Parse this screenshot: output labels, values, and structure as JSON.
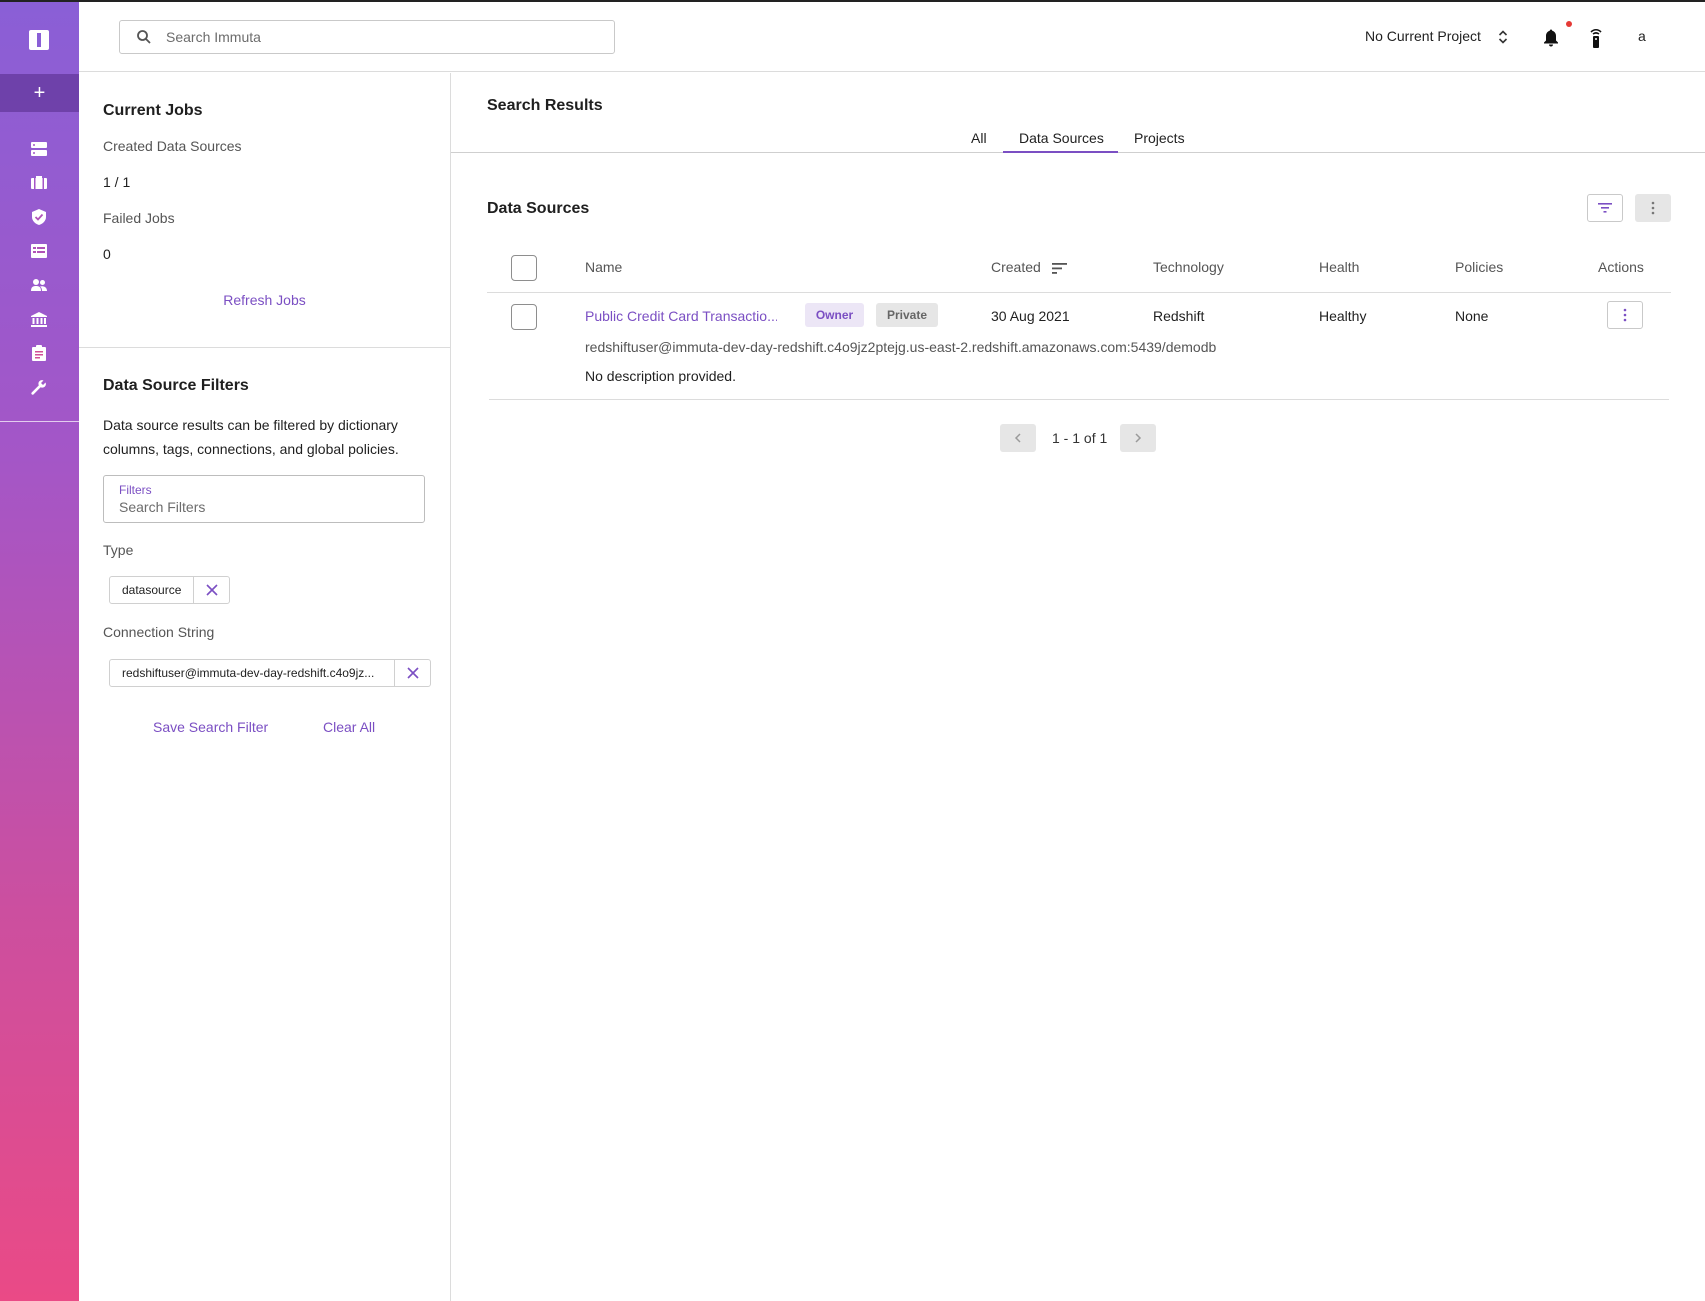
{
  "colors": {
    "accent": "#7b4fc3",
    "rail_top": "#8a5fd6",
    "rail_bottom": "#ea4a86",
    "notification_dot": "#e53935"
  },
  "topbar": {
    "search_placeholder": "Search Immuta",
    "project_label": "No Current Project",
    "user_initial": "a"
  },
  "rail": {
    "add_label": "+",
    "icons": [
      "data-sources-icon",
      "projects-icon",
      "policies-icon",
      "query-editor-icon",
      "people-icon",
      "governance-icon",
      "audit-icon",
      "app-settings-icon"
    ]
  },
  "jobs": {
    "title": "Current Jobs",
    "created_label": "Created Data Sources",
    "created_value": "1 / 1",
    "failed_label": "Failed Jobs",
    "failed_value": "0",
    "refresh_label": "Refresh Jobs"
  },
  "filters": {
    "title": "Data Source Filters",
    "description_line1": "Data source results can be filtered by dictionary",
    "description_line2": "columns, tags, connections, and global policies.",
    "field_label": "Filters",
    "field_placeholder": "Search Filters",
    "type_label": "Type",
    "type_chip": "datasource",
    "conn_label": "Connection String",
    "conn_chip": "redshiftuser@immuta-dev-day-redshift.c4o9jz...",
    "save_label": "Save Search Filter",
    "clear_label": "Clear All"
  },
  "main": {
    "title": "Search Results",
    "tabs": [
      {
        "label": "All"
      },
      {
        "label": "Data Sources"
      },
      {
        "label": "Projects"
      }
    ],
    "section_title": "Data Sources",
    "columns": {
      "name": "Name",
      "created": "Created",
      "technology": "Technology",
      "health": "Health",
      "policies": "Policies",
      "actions": "Actions"
    },
    "rows": [
      {
        "name": "Public Credit Card Transactio...",
        "badge_owner": "Owner",
        "badge_private": "Private",
        "created": "30 Aug 2021",
        "technology": "Redshift",
        "health": "Healthy",
        "policies": "None",
        "connection": "redshiftuser@immuta-dev-day-redshift.c4o9jz2ptejg.us-east-2.redshift.amazonaws.com:5439/demodb",
        "description": "No description provided."
      }
    ],
    "pagination": "1 - 1 of 1"
  }
}
